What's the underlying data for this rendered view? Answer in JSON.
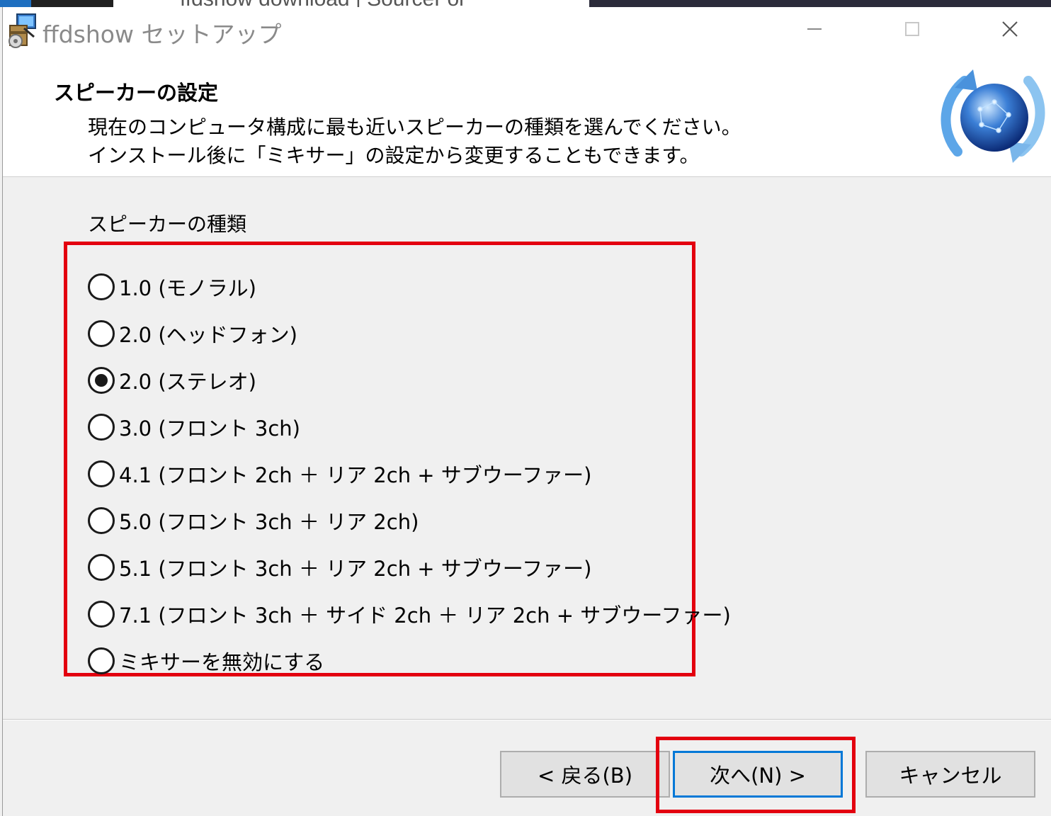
{
  "background": {
    "tab_text": "ffdshow download | SourceFor",
    "tab_close": "✕"
  },
  "window": {
    "title": "ffdshow セットアップ",
    "minimize_icon": "minimize-icon",
    "maximize_icon": "maximize-icon",
    "close_icon": "close-icon"
  },
  "header": {
    "title": "スピーカーの設定",
    "description_line1": "現在のコンピュータ構成に最も近いスピーカーの種類を選んでください。",
    "description_line2": "インストール後に「ミキサー」の設定から変更することもできます。"
  },
  "speakers": {
    "group_label": "スピーカーの種類",
    "options": [
      {
        "label": "1.0 (モノラル)",
        "checked": false
      },
      {
        "label": "2.0 (ヘッドフォン)",
        "checked": false
      },
      {
        "label": "2.0 (ステレオ)",
        "checked": true
      },
      {
        "label": "3.0 (フロント 3ch)",
        "checked": false
      },
      {
        "label": "4.1 (フロント 2ch ＋ リア 2ch + サブウーファー)",
        "checked": false
      },
      {
        "label": "5.0 (フロント 3ch ＋ リア 2ch)",
        "checked": false
      },
      {
        "label": "5.1 (フロント 3ch ＋ リア 2ch + サブウーファー)",
        "checked": false
      },
      {
        "label": "7.1 (フロント 3ch ＋ サイド 2ch ＋ リア 2ch + サブウーファー)",
        "checked": false
      },
      {
        "label": "ミキサーを無効にする",
        "checked": false
      }
    ]
  },
  "buttons": {
    "back_label": "< 戻る(B)",
    "next_label": "次へ(N) >",
    "cancel_label": "キャンセル"
  },
  "colors": {
    "highlight": "#e3000f",
    "focus": "#0078d7"
  }
}
